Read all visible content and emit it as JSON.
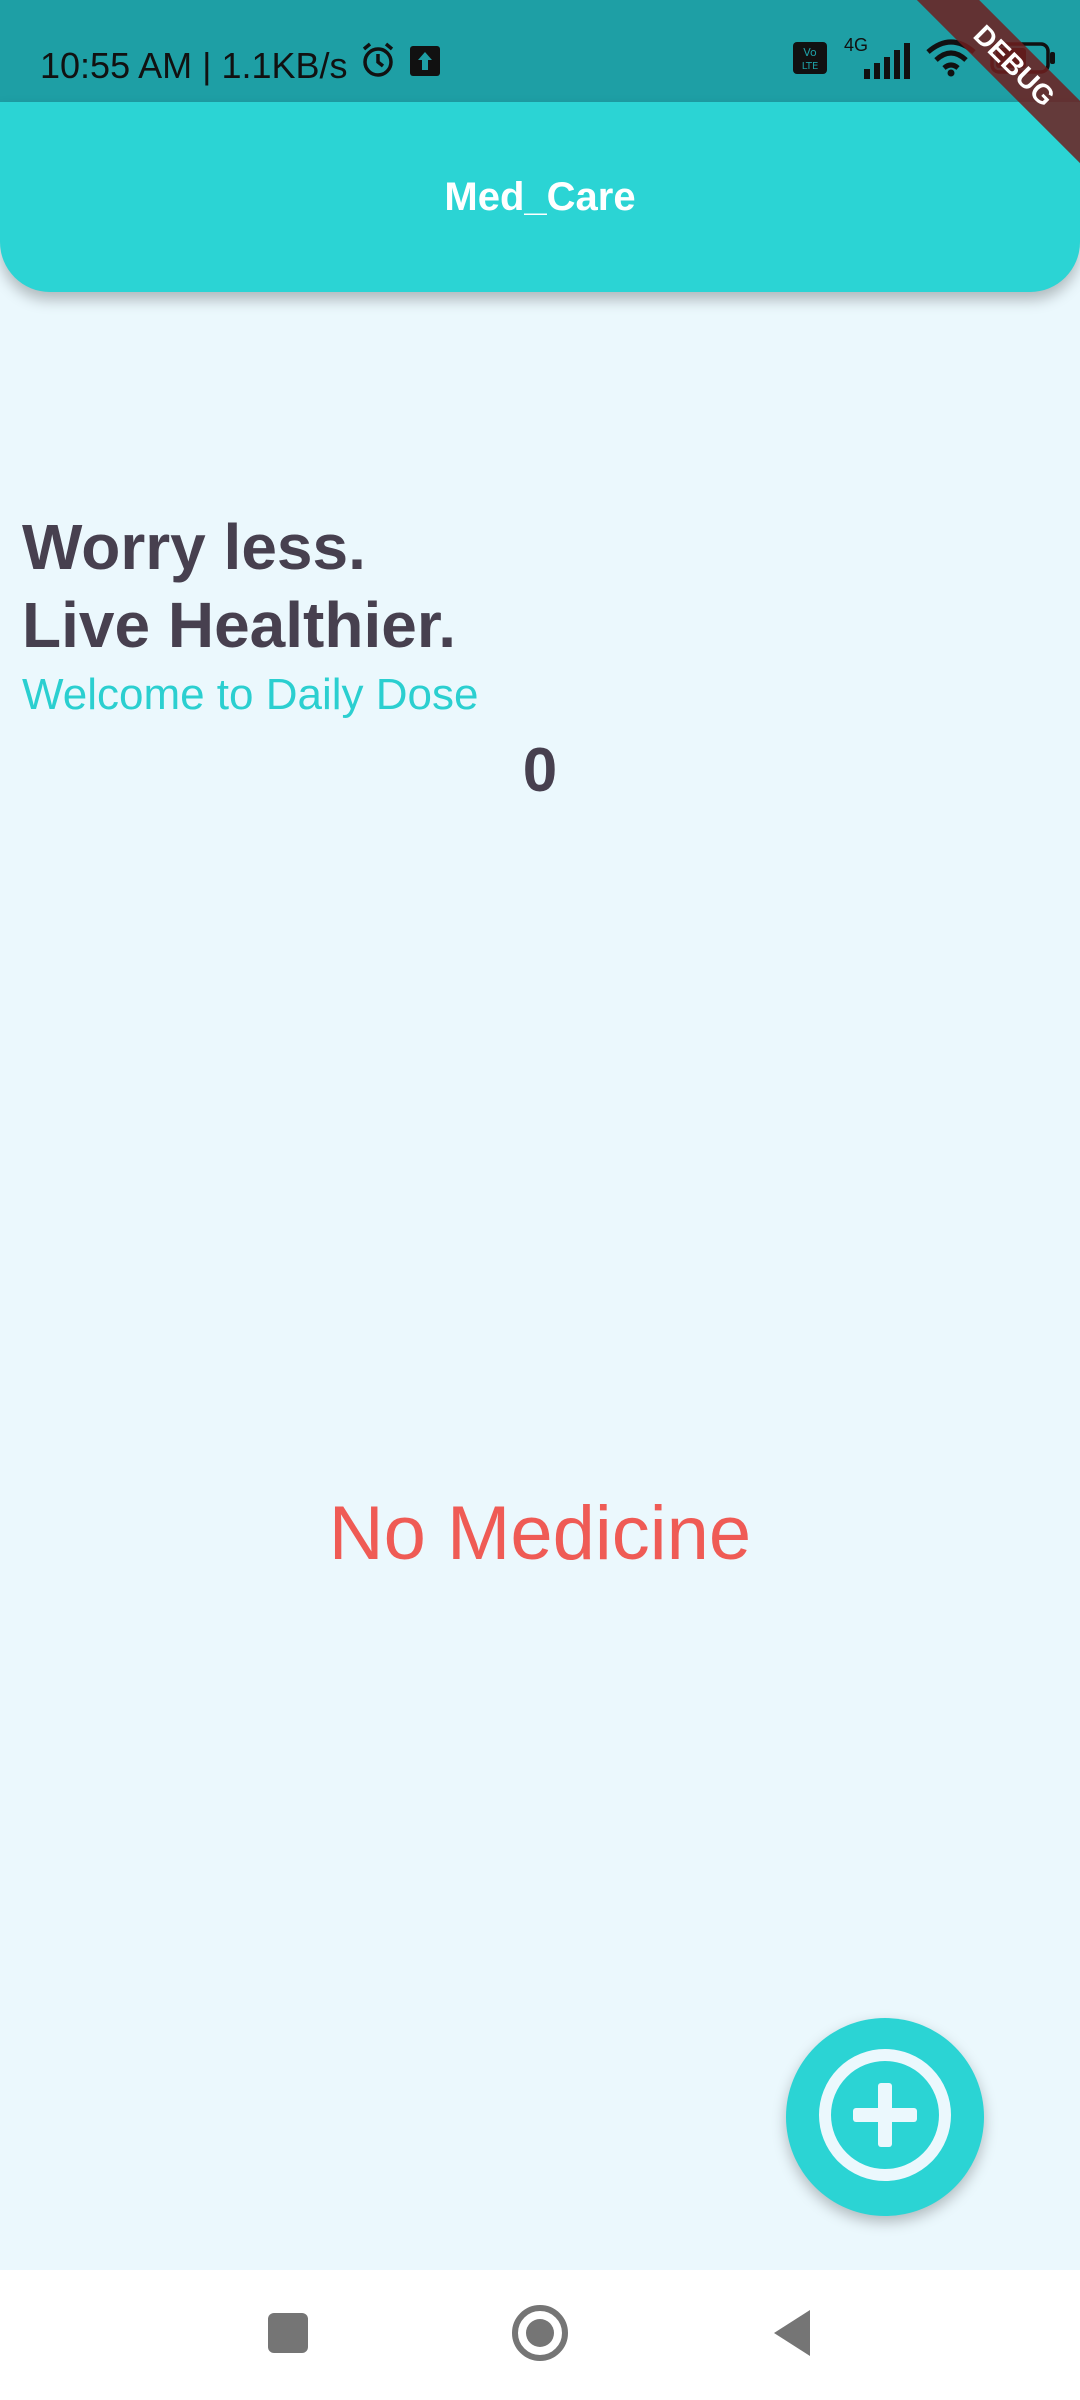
{
  "status_bar": {
    "time_speed": "10:55 AM | 1.1KB/s",
    "icons": [
      "alarm-icon",
      "upload-icon",
      "volte-icon",
      "signal-4g-icon",
      "wifi-icon",
      "battery-icon"
    ],
    "network_label": "4G"
  },
  "app_bar": {
    "title": "Med_Care",
    "debug_banner": "DEBUG"
  },
  "main": {
    "headline_line1": "Worry less.",
    "headline_line2": "Live Healthier.",
    "welcome": "Welcome to Daily Dose",
    "count": "0",
    "empty_message": "No Medicine"
  },
  "fab": {
    "icon": "add-circle-icon"
  },
  "nav_bar": {
    "buttons": [
      "recents-icon",
      "home-icon",
      "back-icon"
    ]
  },
  "colors": {
    "accent": "#2bd4d4",
    "status_bar": "#1e9fa5",
    "background": "#ebf8fd",
    "heading": "#47404f",
    "empty": "#ef5b55"
  }
}
